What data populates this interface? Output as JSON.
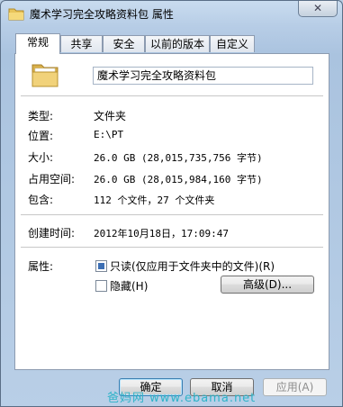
{
  "window": {
    "title": "魔术学习完全攻略资料包 属性",
    "close_glyph": "✕"
  },
  "tabs": [
    {
      "label": "常规",
      "active": true
    },
    {
      "label": "共享",
      "active": false
    },
    {
      "label": "安全",
      "active": false
    },
    {
      "label": "以前的版本",
      "active": false
    },
    {
      "label": "自定义",
      "active": false
    }
  ],
  "general": {
    "folder_name": "魔术学习完全攻略资料包",
    "type_label": "类型:",
    "type_value": "文件夹",
    "location_label": "位置:",
    "location_value": "E:\\PT",
    "size_label": "大小:",
    "size_value": "26.0 GB (28,015,735,756 字节)",
    "size_on_disk_label": "占用空间:",
    "size_on_disk_value": "26.0 GB (28,015,984,160 字节)",
    "contains_label": "包含:",
    "contains_value": "112 个文件，27 个文件夹",
    "created_label": "创建时间:",
    "created_value": "2012年10月18日，17:09:47",
    "attributes_label": "属性:",
    "readonly_label": "只读(仅应用于文件夹中的文件)(R)",
    "readonly_checked": true,
    "hidden_label": "隐藏(H)",
    "hidden_checked": false,
    "advanced_button": "高级(D)..."
  },
  "buttons": {
    "ok": "确定",
    "cancel": "取消",
    "apply": "应用(A)"
  },
  "watermark": "爸妈网 www.ebama.net",
  "colors": {
    "accent": "#3c6fb4",
    "watermark": "#2fb3c8"
  }
}
